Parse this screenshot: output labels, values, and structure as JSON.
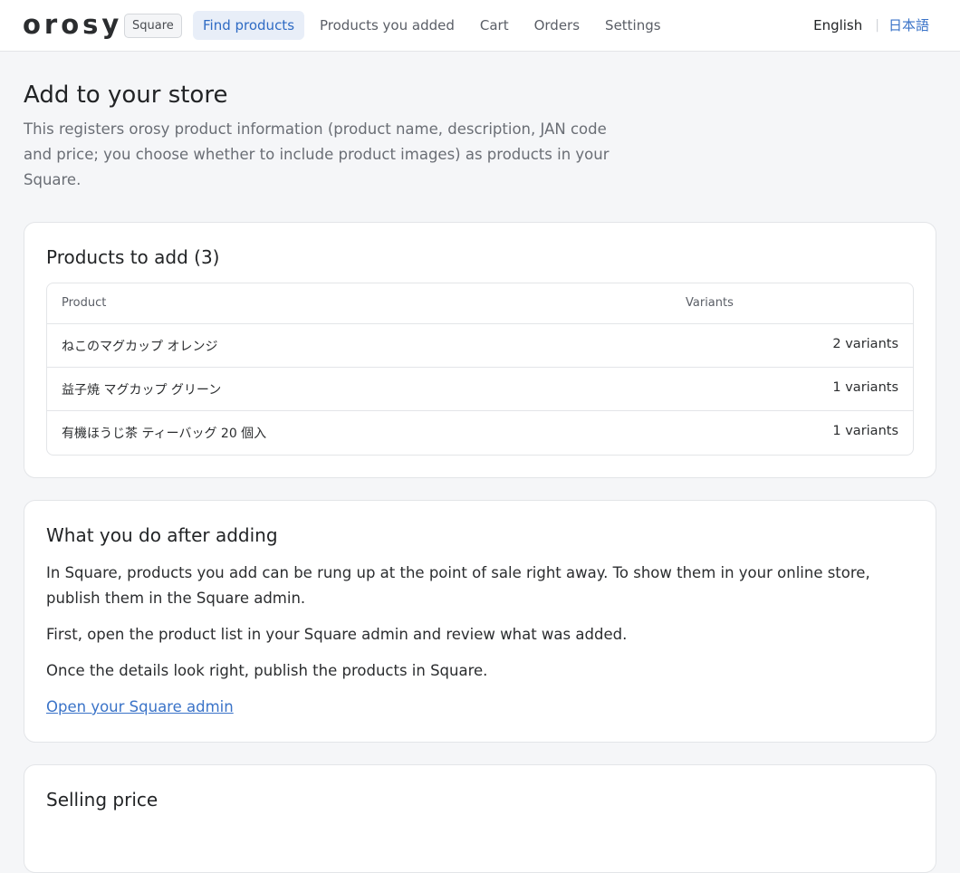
{
  "header": {
    "logo": "orosy",
    "platform": "Square",
    "nav": [
      {
        "label": "Find products",
        "active": true
      },
      {
        "label": "Products you added",
        "active": false
      },
      {
        "label": "Cart",
        "active": false
      },
      {
        "label": "Orders",
        "active": false
      },
      {
        "label": "Settings",
        "active": false
      }
    ],
    "lang_current": "English",
    "lang_separator": "|",
    "lang_other": "日本語"
  },
  "page": {
    "title": "Add to your store",
    "description": "This registers orosy product information (product name, description, JAN code and price; you choose whether to include product images) as products in your Square."
  },
  "products_card": {
    "title": "Products to add (3)",
    "columns": {
      "product": "Product",
      "variants": "Variants"
    },
    "rows": [
      {
        "product": "ねこのマグカップ オレンジ",
        "variants": "2 variants"
      },
      {
        "product": "益子焼 マグカップ グリーン",
        "variants": "1 variants"
      },
      {
        "product": "有機ほうじ茶 ティーバッグ 20 個入",
        "variants": "1 variants"
      }
    ]
  },
  "after_card": {
    "title": "What you do after adding",
    "para1": "In Square, products you add can be rung up at the point of sale right away. To show them in your online store, publish them in the Square admin.",
    "para2": "First, open the product list in your Square admin and review what was added.",
    "para3": "Once the details look right, publish the products in Square.",
    "link": "Open your Square admin"
  },
  "price_card": {
    "title": "Selling price"
  },
  "colors": {
    "accent": "#3a73c8",
    "nav_active_bg": "#e8eef8",
    "page_bg": "#f5f6f8"
  }
}
